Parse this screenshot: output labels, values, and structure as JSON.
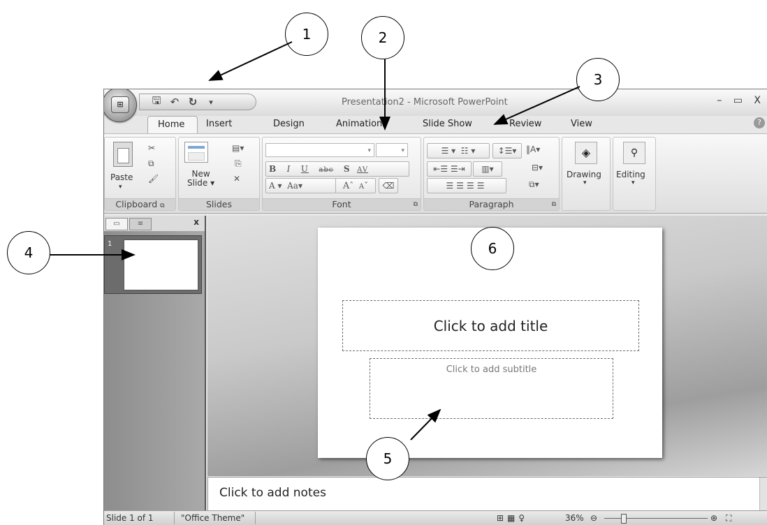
{
  "window": {
    "title": "Presentation2 - Microsoft PowerPoint",
    "office_button_label": "Office Button",
    "window_controls": "–  ▭  X"
  },
  "tabs": [
    "Home",
    "Insert",
    "Design",
    "Animations",
    "Slide Show",
    "Review",
    "View"
  ],
  "ribbon": {
    "clipboard": {
      "label": "Clipboard",
      "paste": "Paste"
    },
    "slides": {
      "label": "Slides",
      "new_slide_line1": "New",
      "new_slide_line2": "Slide ▾"
    },
    "font": {
      "label": "Font",
      "bold": "B",
      "italic": "I",
      "underline": "U",
      "strike": "abc",
      "shadow": "S",
      "spacing": "AV",
      "color": "A",
      "case": "Aa",
      "grow": "A",
      "shrink": "A"
    },
    "paragraph": {
      "label": "Paragraph"
    },
    "drawing": {
      "label": "Drawing"
    },
    "editing": {
      "label": "Editing"
    }
  },
  "slides_pane": {
    "close": "x",
    "thumb_number": "1"
  },
  "slide": {
    "title_placeholder": "Click to add title",
    "subtitle_placeholder": "Click to add subtitle"
  },
  "notes": {
    "placeholder": "Click to add notes"
  },
  "status": {
    "slide_info": "Slide 1 of 1",
    "theme": "\"Office Theme\"",
    "zoom": "36%"
  },
  "callouts": [
    "1",
    "2",
    "3",
    "4",
    "5",
    "6"
  ]
}
